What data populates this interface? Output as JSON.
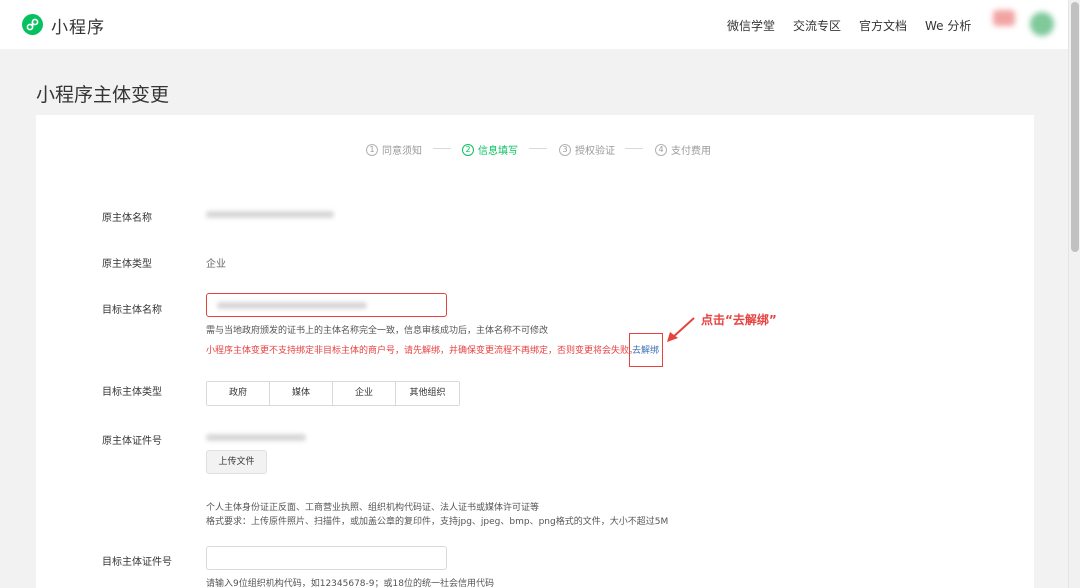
{
  "header": {
    "brand": "小程序",
    "nav": [
      "微信学堂",
      "交流专区",
      "官方文档",
      "We 分析"
    ]
  },
  "page": {
    "title": "小程序主体变更"
  },
  "steps": [
    {
      "num": "1",
      "label": "同意须知"
    },
    {
      "num": "2",
      "label": "信息填写"
    },
    {
      "num": "3",
      "label": "授权验证"
    },
    {
      "num": "4",
      "label": "支付费用"
    }
  ],
  "active_step": 2,
  "form": {
    "orig_name_label": "原主体名称",
    "orig_type_label": "原主体类型",
    "orig_type_value": "企业",
    "target_name_label": "目标主体名称",
    "target_name_hint": "需与当地政府颁发的证书上的主体名称完全一致，信息审核成功后，主体名称不可修改",
    "target_name_warning": "小程序主体变更不支持绑定非目标主体的商户号，请先解绑，并确保变更流程不再绑定，否则变更将会失败。",
    "unbind_link": "去解绑",
    "callout": "点击“去解绑”",
    "target_type_label": "目标主体类型",
    "target_type_options": [
      "政府",
      "媒体",
      "企业",
      "其他组织"
    ],
    "orig_cert_label": "原主体证件号",
    "upload_button": "上传文件",
    "upload_hint_1": "个人主体身份证正反面、工商营业执照、组织机构代码证、法人证书或媒体许可证等",
    "upload_hint_2": "格式要求：上传原件照片、扫描件，或加盖公章的复印件，支持jpg、jpeg、bmp、png格式的文件，大小不超过5M",
    "target_cert_label": "目标主体证件号",
    "target_cert_hint": "请输入9位组织机构代码，如12345678-9；或18位的统一社会信用代码"
  },
  "colors": {
    "brand_green": "#07c160",
    "warning_red": "#e64340",
    "link_blue": "#3b6fb4"
  }
}
